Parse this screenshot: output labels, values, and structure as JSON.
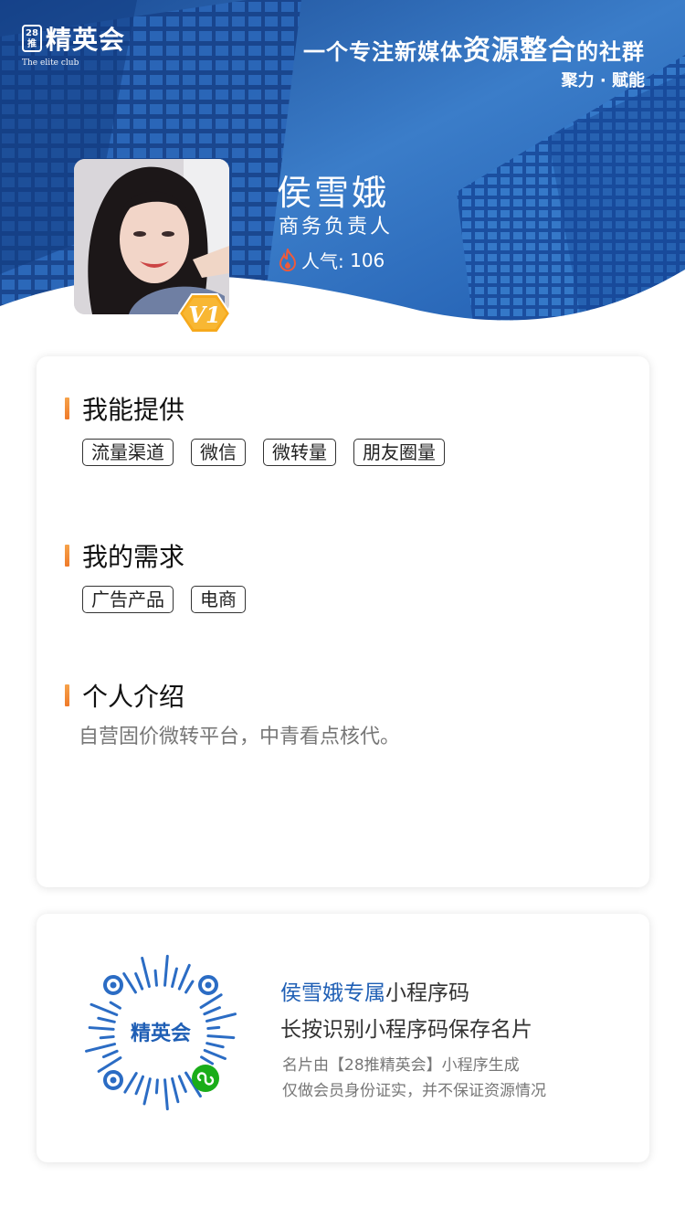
{
  "header": {
    "logo_seal": "28推",
    "logo_text": "精英会",
    "logo_subtitle": "The elite club",
    "slogan_part1": "一个专注新媒体",
    "slogan_highlight": "资源整合",
    "slogan_part2": "的社群",
    "tagline": "聚力 · 赋能"
  },
  "profile": {
    "name": "侯雪娥",
    "title": "商务负责人",
    "popularity_label": "人气:",
    "popularity_value": "106",
    "level_badge": "V1"
  },
  "offer": {
    "title": "我能提供",
    "tags": [
      "流量渠道",
      "微信",
      "微转量",
      "朋友圈量"
    ]
  },
  "needs": {
    "title": "我的需求",
    "tags": [
      "广告产品",
      "电商"
    ]
  },
  "intro": {
    "title": "个人介绍",
    "text": "自营固价微转平台，中青看点核代。"
  },
  "qrcard": {
    "line1_highlight": "侯雪娥专属",
    "line1_rest": "小程序码",
    "line2": "长按识别小程序码保存名片",
    "line3": "名片由【28推精英会】小程序生成",
    "line4": "仅做会员身份证实，并不保证资源情况",
    "qr_logo_text": "精英会"
  },
  "colors": {
    "hero_blue": "#1b4f9c",
    "accent_orange": "#f08a30",
    "highlight_blue": "#1f5fb5",
    "wechat_green": "#1aad19"
  }
}
